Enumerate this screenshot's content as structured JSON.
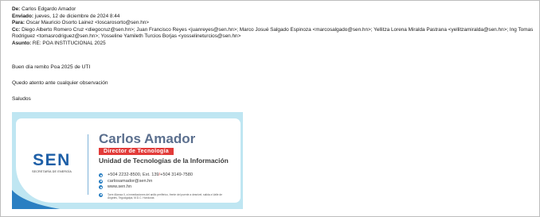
{
  "email": {
    "from_label": "De:",
    "from": "Carlos Edgardo Amador",
    "sent_label": "Enviado:",
    "sent": "jueves, 12 de diciembre de 2024 8:44",
    "to_label": "Para:",
    "to": "Oscar Mauricio Osorto Lainez <loscarosorto@sen.hn>",
    "cc_label": "Cc:",
    "cc": "Diego Alberto Romero Cruz <diegocruz@sen.hn>; Juan Francisco Reyes <juanreyes@sen.hn>; Marco Josué Salgado Espinoza <marcosalgado@sen.hn>; Yellitza Lorena Miralda Pastrana <yellitzamiralda@sen.hn>; Ing Tomas Rodriguez <tomasrodriguez@sen.hn>; Yosseline Yamileth Turcios Borjas <yosselineturcios@sen.hn>",
    "subject_label": "Asunto:",
    "subject": "RE: POA INSTITUCIONAL 2025"
  },
  "body": {
    "line1": "Buen día remito Poa 2025 de UTI",
    "line2": "Quedo atento ante cualquier observación",
    "line3": "Saludos"
  },
  "signature": {
    "logo_text": "SEN",
    "logo_sub": "SECRETARÍA DE ENERGÍA",
    "name": "Carlos Amador",
    "role": "Director de Tecnología",
    "unit": "Unidad de Tecnologías de la Información",
    "phone_main": "+504 2232-8500, Ext. 139",
    "phone_sep": " / ",
    "phone_alt": "+504 3149-7580",
    "email": "carlosamador@sen.hn",
    "web": "www.sen.hn",
    "address": "Torre Alianza II, a inmediaciones del anillo periférico, frente del puente a desnivel, salida a Valle de Ángeles, Tegucigalpa, M.D.C. Honduras",
    "colors": {
      "brand_blue": "#1e5fa7",
      "accent_red": "#e23b39",
      "background_teal": "#bfe6f2"
    },
    "icons": [
      "phone-icon",
      "email-icon",
      "web-icon",
      "location-icon"
    ]
  }
}
